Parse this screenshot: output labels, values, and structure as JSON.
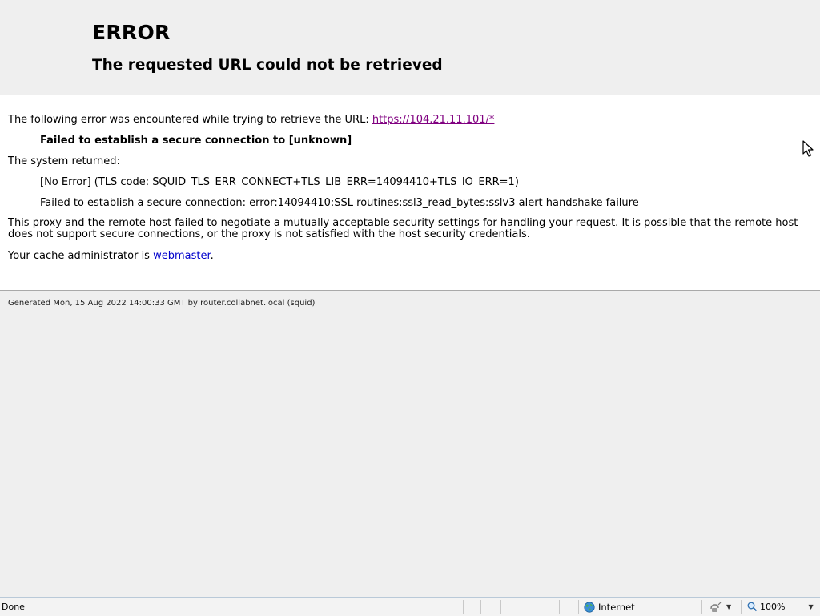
{
  "header": {
    "title": "ERROR",
    "subtitle": "The requested URL could not be retrieved"
  },
  "content": {
    "intro_text": "The following error was encountered while trying to retrieve the URL: ",
    "url_link": "https://104.21.11.101/*",
    "failure_message": "Failed to establish a secure connection to [unknown]",
    "system_returned_label": "The system returned:",
    "tls_error": "[No Error] (TLS code: SQUID_TLS_ERR_CONNECT+TLS_LIB_ERR=14094410+TLS_IO_ERR=1)",
    "ssl_error": "Failed to establish a secure connection: error:14094410:SSL routines:ssl3_read_bytes:sslv3 alert handshake failure",
    "explanation": "This proxy and the remote host failed to negotiate a mutually acceptable security settings for handling your request. It is possible that the remote host does not support secure connections, or the proxy is not satisfied with the host security credentials.",
    "admin_prefix": "Your cache administrator is ",
    "admin_link": "webmaster",
    "admin_suffix": "."
  },
  "footer": {
    "generated": "Generated Mon, 15 Aug 2022 14:00:33 GMT by router.collabnet.local (squid)"
  },
  "statusbar": {
    "status": "Done",
    "zone": "Internet",
    "zoom": "100%",
    "zone_icon": "globe-icon",
    "protected_mode_icon": "protected-mode-icon",
    "zoom_icon": "magnifier-icon"
  },
  "colors": {
    "page_background": "#efefef",
    "content_background": "#ffffff",
    "visited_link": "#800080",
    "link": "#0000cc"
  }
}
